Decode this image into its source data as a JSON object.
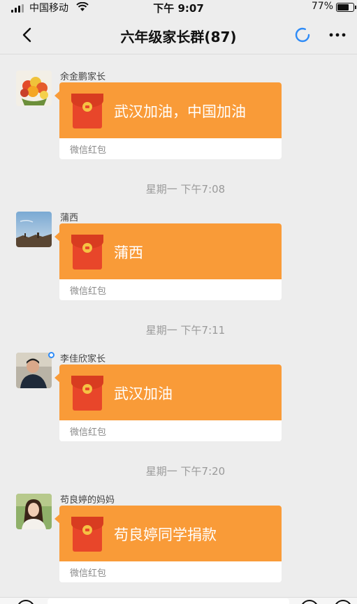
{
  "status_bar": {
    "carrier": "中国移动",
    "time": "下午 9:07",
    "battery": "77%",
    "battery_level": 0.77
  },
  "nav": {
    "title": "六年级家长群(87)"
  },
  "messages": [
    {
      "sender": "余金鹏家长",
      "text": "武汉加油，中国加油",
      "label": "微信红包"
    },
    {
      "timestamp": "星期一 下午7:08",
      "sender": "蒲西",
      "text": "蒲西",
      "label": "微信红包"
    },
    {
      "timestamp": "星期一 下午7:11",
      "sender": "李佳欣家长",
      "text": "武汉加油",
      "label": "微信红包"
    },
    {
      "timestamp": "星期一 下午7:20",
      "sender": "苟良婷的妈妈",
      "text": "苟良婷同学捐款",
      "label": "微信红包"
    }
  ],
  "colors": {
    "packet_orange": "#f99b38",
    "packet_red": "#e8462a",
    "background": "#ededed",
    "accent_blue": "#2e8bf7"
  }
}
